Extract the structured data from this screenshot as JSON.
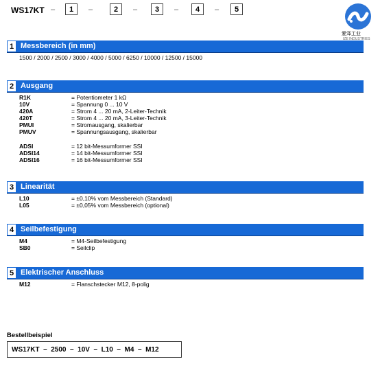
{
  "header": {
    "model": "WS17KT",
    "dash": "–",
    "boxes": [
      "1",
      "2",
      "3",
      "4",
      "5"
    ]
  },
  "logo": {
    "chinese_text": "爱泽工业",
    "english_text": "IZE INDUSTRIES",
    "brand_color": "#2b74d6"
  },
  "sections": [
    {
      "number": "1",
      "title": "Messbereich (in mm)",
      "text": "1500 / 2000 / 2500 / 3000 / 4000 / 5000 / 6250 / 10000 / 12500 / 15000"
    },
    {
      "number": "2",
      "title": "Ausgang",
      "rows": [
        {
          "code": "R1K",
          "desc": "= Potentiometer 1 kΩ"
        },
        {
          "code": "10V",
          "desc": "= Spannung 0 ... 10 V"
        },
        {
          "code": "420A",
          "desc": "= Strom 4 ... 20 mA, 2-Leiter-Technik"
        },
        {
          "code": "420T",
          "desc": "= Strom 4 ... 20 mA, 3-Leiter-Technik"
        },
        {
          "code": "PMUI",
          "desc": "= Stromausgang, skalierbar"
        },
        {
          "code": "PMUV",
          "desc": "= Spannungsausgang, skalierbar"
        },
        {
          "code": "ADSI",
          "desc": "= 12 bit-Messumformer SSI"
        },
        {
          "code": "ADSI14",
          "desc": "= 14 bit-Messumformer SSI"
        },
        {
          "code": "ADSI16",
          "desc": "= 16 bit-Messumformer SSI"
        }
      ]
    },
    {
      "number": "3",
      "title": "Linearität",
      "rows": [
        {
          "code": "L10",
          "desc": "= ±0,10% vom Messbereich (Standard)"
        },
        {
          "code": "L05",
          "desc": "= ±0,05% vom Messbereich (optional)"
        }
      ]
    },
    {
      "number": "4",
      "title": "Seilbefestigung",
      "rows": [
        {
          "code": "M4",
          "desc": "= M4-Seilbefestigung"
        },
        {
          "code": "SB0",
          "desc": "= Seilclip"
        }
      ]
    },
    {
      "number": "5",
      "title": "Elektrischer Anschluss",
      "rows": [
        {
          "code": "M12",
          "desc": "= Flanschstecker M12, 8-polig"
        }
      ]
    }
  ],
  "example": {
    "label": "Bestellbeispiel",
    "code": "WS17KT  –  2500  –  10V  –  L10  –  M4  –  M12"
  }
}
